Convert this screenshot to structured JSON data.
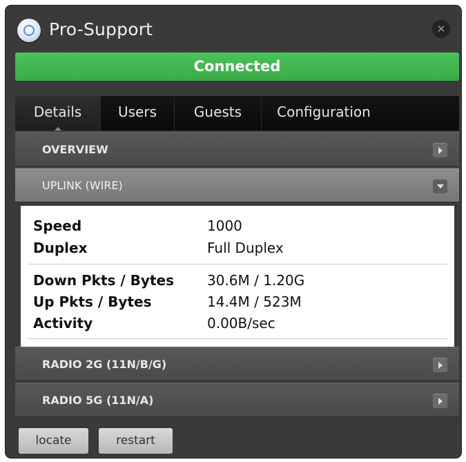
{
  "window": {
    "title": "Pro-Support",
    "app_icon": "network-device-icon",
    "close_icon": "close-icon"
  },
  "status": {
    "text": "Connected",
    "color": "#3db84c"
  },
  "tabs": [
    {
      "label": "Details",
      "active": true
    },
    {
      "label": "Users",
      "active": false
    },
    {
      "label": "Guests",
      "active": false
    },
    {
      "label": "Configuration",
      "active": false
    }
  ],
  "sections": {
    "overview": {
      "label": "OVERVIEW",
      "expanded": false
    },
    "uplink": {
      "label": "UPLINK (WIRE)",
      "expanded": true
    },
    "radio2g": {
      "label": "RADIO 2G (11N/B/G)",
      "expanded": false
    },
    "radio5g": {
      "label": "RADIO 5G (11N/A)",
      "expanded": false
    }
  },
  "uplink_details": {
    "speed": {
      "label": "Speed",
      "value": "1000"
    },
    "duplex": {
      "label": "Duplex",
      "value": "Full Duplex"
    },
    "down": {
      "label": "Down Pkts / Bytes",
      "value": "30.6M / 1.20G"
    },
    "up": {
      "label": "Up Pkts / Bytes",
      "value": "14.4M / 523M"
    },
    "activity": {
      "label": "Activity",
      "value": "0.00B/sec"
    }
  },
  "buttons": {
    "locate": "locate",
    "restart": "restart"
  }
}
